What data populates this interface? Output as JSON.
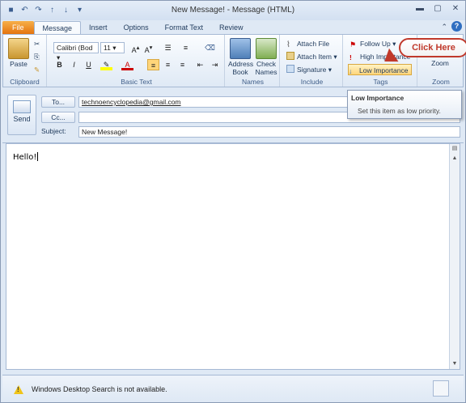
{
  "window": {
    "title": "New Message!  -  Message (HTML)",
    "controls": [
      "▬",
      "▢",
      "✕"
    ]
  },
  "qat": [
    "save",
    "undo",
    "redo",
    "up",
    "down",
    "customize"
  ],
  "tabs": [
    {
      "label": "File"
    },
    {
      "label": "Message"
    },
    {
      "label": "Insert"
    },
    {
      "label": "Options"
    },
    {
      "label": "Format Text"
    },
    {
      "label": "Review"
    }
  ],
  "ribbon": {
    "clipboard": {
      "label": "Clipboard",
      "paste": "Paste"
    },
    "basic_text": {
      "label": "Basic Text",
      "font": "Calibri (Bod",
      "size": "11"
    },
    "names": {
      "label": "Names",
      "address_book": [
        "Address",
        "Book"
      ],
      "check_names": [
        "Check",
        "Names"
      ]
    },
    "include": {
      "label": "Include",
      "attach_file": "Attach File",
      "attach_item": "Attach Item ▾",
      "signature": "Signature ▾"
    },
    "tags": {
      "label": "Tags",
      "follow_up": "Follow Up ▾",
      "high_importance": "High Importance",
      "low_importance": "Low Importance"
    },
    "zoom": {
      "label": "Zoom",
      "zoom": "Zoom"
    }
  },
  "callout": {
    "text": "Click Here"
  },
  "tooltip": {
    "title": "Low Importance",
    "body": "Set this item as low priority."
  },
  "header": {
    "send": "Send",
    "to_label": "To...",
    "to_value": "technoencyclopedia@gmail.com",
    "cc_label": "Cc...",
    "cc_value": "",
    "subject_label": "Subject:",
    "subject_value": "New Message!"
  },
  "body": {
    "text": "Hello!"
  },
  "status": {
    "text": "Windows Desktop Search is not available."
  }
}
